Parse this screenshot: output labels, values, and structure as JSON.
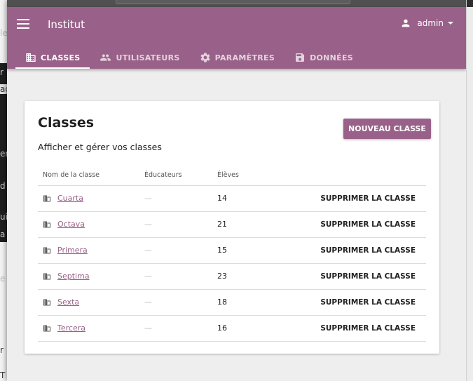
{
  "background": {
    "fragments": [
      "le",
      "r",
      "ag",
      "er",
      "d",
      "ui",
      "a",
      "e",
      "r",
      "T"
    ]
  },
  "appbar": {
    "title": "Institut",
    "user": "admin",
    "tabs": [
      {
        "label": "CLASSES",
        "icon": "classes-icon",
        "active": true
      },
      {
        "label": "UTILISATEURS",
        "icon": "people-icon",
        "active": false
      },
      {
        "label": "PARAMÈTRES",
        "icon": "gear-icon",
        "active": false
      },
      {
        "label": "DONNÉES",
        "icon": "save-icon",
        "active": false
      }
    ]
  },
  "card": {
    "title": "Classes",
    "description": "Afficher et gérer vos classes",
    "new_button": "NOUVEAU CLASSE",
    "columns": [
      "Nom de la classe",
      "Éducateurs",
      "Élèves",
      ""
    ],
    "rows": [
      {
        "name": "Cuarta",
        "educators": "—",
        "students": "14",
        "action": "SUPPRIMER LA CLASSE"
      },
      {
        "name": "Octava",
        "educators": "—",
        "students": "21",
        "action": "SUPPRIMER LA CLASSE"
      },
      {
        "name": "Primera",
        "educators": "—",
        "students": "15",
        "action": "SUPPRIMER LA CLASSE"
      },
      {
        "name": "Septima",
        "educators": "—",
        "students": "23",
        "action": "SUPPRIMER LA CLASSE"
      },
      {
        "name": "Sexta",
        "educators": "—",
        "students": "18",
        "action": "SUPPRIMER LA CLASSE"
      },
      {
        "name": "Tercera",
        "educators": "—",
        "students": "16",
        "action": "SUPPRIMER LA CLASSE"
      }
    ]
  },
  "colors": {
    "brand": "#996189",
    "background": "#eeeeee"
  }
}
